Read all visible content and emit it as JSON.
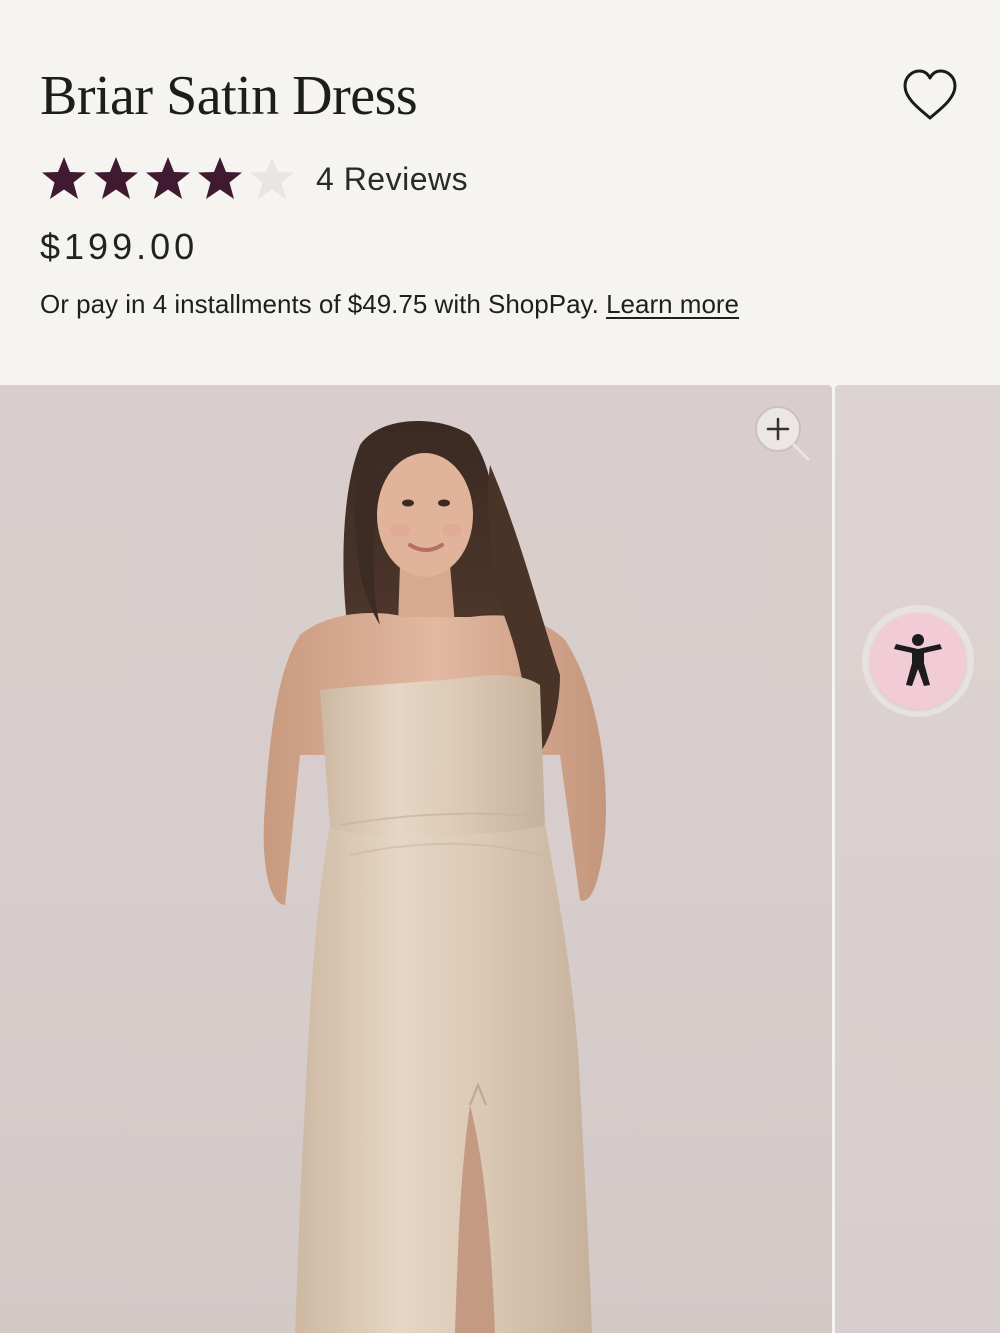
{
  "product": {
    "title": "Briar Satin Dress",
    "rating": 4,
    "max_rating": 5,
    "reviews_label": "4 Reviews",
    "price": "$199.00",
    "installments_text": "Or pay in 4 installments of $49.75 with ShopPay.",
    "learn_more_label": "Learn more"
  },
  "colors": {
    "star_filled": "#3f1a30",
    "star_empty": "#e8e6e4",
    "page_background": "#f5f4f1",
    "accessibility_button": "#f1ccd6"
  },
  "icons": {
    "wishlist": "heart-outline-icon",
    "zoom": "zoom-in-icon",
    "accessibility": "accessibility-person-icon"
  }
}
